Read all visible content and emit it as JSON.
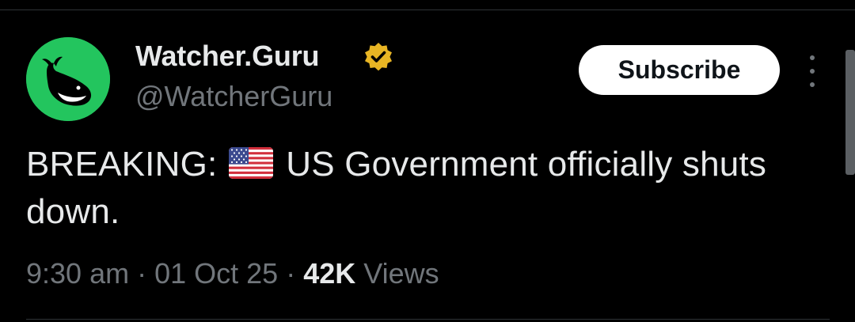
{
  "tweet": {
    "author": {
      "display_name": "Watcher.Guru",
      "handle": "@WatcherGuru",
      "avatar_icon": "whale-logo-icon",
      "avatar_color": "#23c55e",
      "verified_icon": "verified-badge-icon",
      "verified_color": "#e8b524"
    },
    "subscribe_label": "Subscribe",
    "more_icon": "vertical-ellipsis-icon",
    "text": {
      "prefix": "BREAKING:",
      "flag_icon": "us-flag-icon",
      "body": "US Government officially shuts down."
    },
    "meta": {
      "time": "9:30 am",
      "sep1": "·",
      "date": "01 Oct 25",
      "sep2": "·",
      "views_count": "42K",
      "views_label": "Views"
    }
  },
  "colors": {
    "background": "#000000",
    "primary_text": "#e7e9ea",
    "secondary_text": "#71767b"
  }
}
